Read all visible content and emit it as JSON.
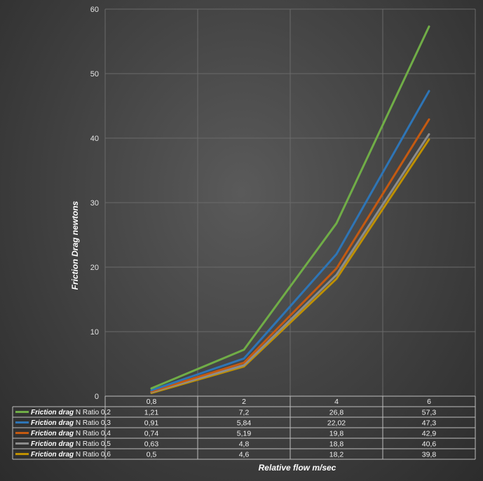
{
  "chart_data": {
    "type": "line",
    "xlabel": "Relative flow m/sec",
    "ylabel": "Friction Drag newtons",
    "ylim": [
      0,
      60
    ],
    "yticks": [
      "0",
      "10",
      "20",
      "30",
      "40",
      "50",
      "60"
    ],
    "categories": [
      "0,8",
      "2",
      "4",
      "6"
    ],
    "grid": true,
    "legend": "data-table",
    "series": [
      {
        "name_bold": "Friction drag",
        "name_rest": "N Ratio 0,2",
        "color": "#70ad47",
        "values": [
          1.21,
          7.2,
          26.8,
          57.3
        ],
        "labels": [
          "1,21",
          "7,2",
          "26,8",
          "57,3"
        ]
      },
      {
        "name_bold": "Friction drag",
        "name_rest": "N Ratio 0,3",
        "color": "#2e75b6",
        "values": [
          0.91,
          5.84,
          22.02,
          47.3
        ],
        "labels": [
          "0,91",
          "5,84",
          "22,02",
          "47,3"
        ]
      },
      {
        "name_bold": "Friction drag",
        "name_rest": "N Ratio 0,4",
        "color": "#c55a11",
        "values": [
          0.74,
          5.19,
          19.8,
          42.9
        ],
        "labels": [
          "0,74",
          "5,19",
          "19,8",
          "42,9"
        ]
      },
      {
        "name_bold": "Friction drag",
        "name_rest": "N Ratio 0,5",
        "color": "#8c8c8c",
        "values": [
          0.63,
          4.8,
          18.8,
          40.6
        ],
        "labels": [
          "0,63",
          "4,8",
          "18,8",
          "40,6"
        ]
      },
      {
        "name_bold": "Friction drag",
        "name_rest": "N Ratio 0,6",
        "color": "#bf9000",
        "values": [
          0.5,
          4.6,
          18.2,
          39.8
        ],
        "labels": [
          "0,5",
          "4,6",
          "18,2",
          "39,8"
        ]
      }
    ]
  }
}
